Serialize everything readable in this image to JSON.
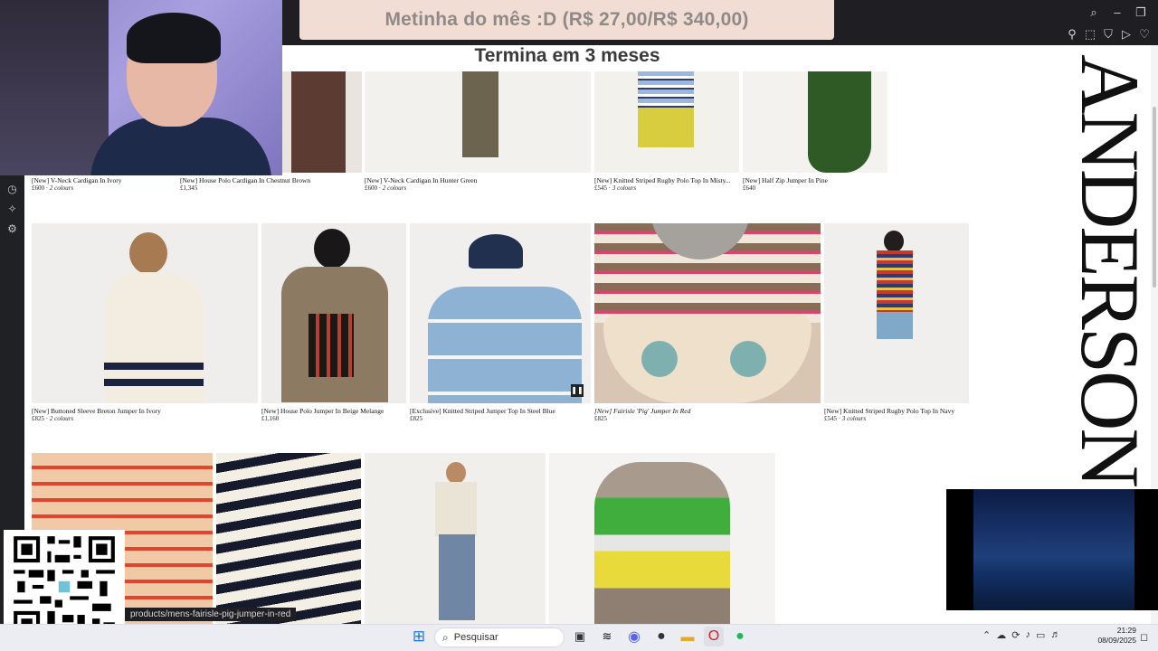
{
  "banner": {
    "goal": "Metinha do mês :D (R$ 27,00/R$ 340,00)",
    "ends": "Termina em 3 meses"
  },
  "brand": {
    "text": "ANDERSON"
  },
  "status_url": "products/mens-fairisle-pig-jumper-in-red",
  "row1": [
    {
      "name": "[New] V-Neck Cardigan In Ivory",
      "price": "£600",
      "colours": "2 colours"
    },
    {
      "name": "[New] House Polo Cardigan In Chestnut Brown",
      "price": "£1,345",
      "colours": ""
    },
    {
      "name": "[New] V-Neck Cardigan In Hunter Green",
      "price": "£600",
      "colours": "2 colours"
    },
    {
      "name": "[New] Knitted Striped Rugby Polo Top In Misty...",
      "price": "£545",
      "colours": "3 colours"
    },
    {
      "name": "[New] Half Zip Jumper In Pine",
      "price": "£640",
      "colours": ""
    }
  ],
  "row2": [
    {
      "name": "[New] Buttoned Sleeve Breton Jumper In Ivory",
      "price": "£825",
      "colours": "2 colours"
    },
    {
      "name": "[New] House Polo Jumper In Beige Melange",
      "price": "£1,160",
      "colours": ""
    },
    {
      "name": "[Exclusive] Knitted Striped Jumper Top In Steel Blue",
      "price": "£825",
      "colours": ""
    },
    {
      "name": "[New] Fairisle 'Pig' Jumper In Red",
      "price": "£825",
      "colours": ""
    },
    {
      "name": "[New] Knitted Striped Rugby Polo Top In Navy",
      "price": "£545",
      "colours": "3 colours"
    }
  ],
  "taskbar": {
    "search_placeholder": "Pesquisar",
    "time": "21:29",
    "date": "08/09/2025"
  },
  "icons": {
    "sidebar": [
      "history-icon",
      "extensions-icon",
      "settings-icon"
    ],
    "toolbar": [
      "search-icon",
      "minimize-icon",
      "restore-icon",
      "close-icon"
    ]
  },
  "colors": {
    "banner_bg": "#f2ddd4",
    "banner_text": "#8f8a88",
    "topbar": "#1f1f23"
  }
}
